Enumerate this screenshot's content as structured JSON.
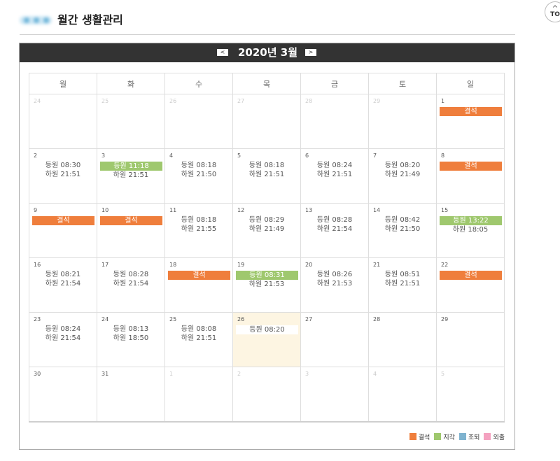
{
  "header": {
    "title": "월간 생활관리"
  },
  "top_button": {
    "label": "TO"
  },
  "calendar": {
    "month_label": "2020년 3월",
    "weekdays": [
      "월",
      "화",
      "수",
      "목",
      "금",
      "토",
      "일"
    ],
    "weeks": [
      [
        {
          "day": "24",
          "other": true
        },
        {
          "day": "25",
          "other": true
        },
        {
          "day": "26",
          "other": true
        },
        {
          "day": "27",
          "other": true
        },
        {
          "day": "28",
          "other": true
        },
        {
          "day": "29",
          "other": true
        },
        {
          "day": "1",
          "badge": "결석",
          "badge_type": "absent"
        }
      ],
      [
        {
          "day": "2",
          "lines": [
            "등원 08:30",
            "하원 21:51"
          ]
        },
        {
          "day": "3",
          "badge": "등원 11:18",
          "badge_type": "late",
          "lines": [
            "하원 21:51"
          ]
        },
        {
          "day": "4",
          "lines": [
            "등원 08:18",
            "하원 21:50"
          ]
        },
        {
          "day": "5",
          "lines": [
            "등원 08:18",
            "하원 21:51"
          ]
        },
        {
          "day": "6",
          "lines": [
            "등원 08:24",
            "하원 21:51"
          ]
        },
        {
          "day": "7",
          "lines": [
            "등원 08:20",
            "하원 21:49"
          ]
        },
        {
          "day": "8",
          "badge": "결석",
          "badge_type": "absent"
        }
      ],
      [
        {
          "day": "9",
          "badge": "결석",
          "badge_type": "absent"
        },
        {
          "day": "10",
          "badge": "결석",
          "badge_type": "absent"
        },
        {
          "day": "11",
          "lines": [
            "등원 08:18",
            "하원 21:55"
          ]
        },
        {
          "day": "12",
          "lines": [
            "등원 08:29",
            "하원 21:49"
          ]
        },
        {
          "day": "13",
          "lines": [
            "등원 08:28",
            "하원 21:54"
          ]
        },
        {
          "day": "14",
          "lines": [
            "등원 08:42",
            "하원 21:50"
          ]
        },
        {
          "day": "15",
          "badge": "등원 13:22",
          "badge_type": "late",
          "lines": [
            "하원 18:05"
          ]
        }
      ],
      [
        {
          "day": "16",
          "lines": [
            "등원 08:21",
            "하원 21:54"
          ]
        },
        {
          "day": "17",
          "lines": [
            "등원 08:28",
            "하원 21:54"
          ]
        },
        {
          "day": "18",
          "badge": "결석",
          "badge_type": "absent"
        },
        {
          "day": "19",
          "badge": "등원 08:31",
          "badge_type": "late",
          "lines": [
            "하원 21:53"
          ]
        },
        {
          "day": "20",
          "lines": [
            "등원 08:26",
            "하원 21:53"
          ]
        },
        {
          "day": "21",
          "lines": [
            "등원 08:51",
            "하원 21:51"
          ]
        },
        {
          "day": "22",
          "badge": "결석",
          "badge_type": "absent"
        }
      ],
      [
        {
          "day": "23",
          "lines": [
            "등원 08:24",
            "하원 21:54"
          ]
        },
        {
          "day": "24",
          "lines": [
            "등원 08:13",
            "하원 18:50"
          ]
        },
        {
          "day": "25",
          "lines": [
            "등원 08:08",
            "하원 21:51"
          ]
        },
        {
          "day": "26",
          "today": true,
          "badge": "등원 08:20",
          "badge_type": "plain"
        },
        {
          "day": "27"
        },
        {
          "day": "28"
        },
        {
          "day": "29"
        }
      ],
      [
        {
          "day": "30"
        },
        {
          "day": "31"
        },
        {
          "day": "1",
          "other": true
        },
        {
          "day": "2",
          "other": true
        },
        {
          "day": "3",
          "other": true
        },
        {
          "day": "4",
          "other": true
        },
        {
          "day": "5",
          "other": true
        }
      ]
    ]
  },
  "legend": [
    {
      "label": "결석",
      "color": "#ef7e3c"
    },
    {
      "label": "지각",
      "color": "#9fc86e"
    },
    {
      "label": "조퇴",
      "color": "#7fb3cf"
    },
    {
      "label": "외출",
      "color": "#f4a2c0"
    }
  ],
  "icons": {
    "prev": "chevron-left-icon",
    "next": "chevron-right-icon",
    "top": "arrow-up-icon"
  }
}
